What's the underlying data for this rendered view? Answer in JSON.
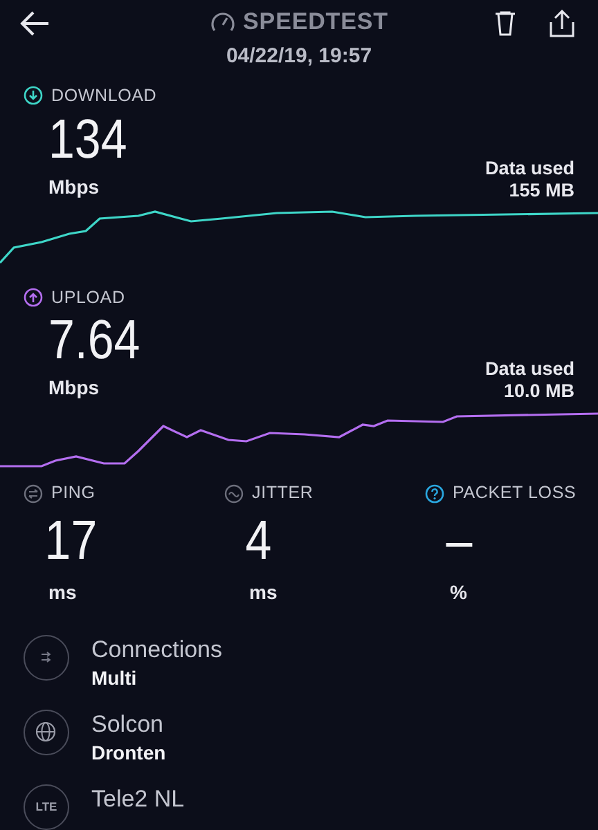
{
  "header": {
    "title": "SPEEDTEST",
    "date": "04/22/19, 19:57"
  },
  "results": [
    {
      "kind": "download",
      "label": "DOWNLOAD",
      "value": "134",
      "unit": "Mbps",
      "data_label": "Data used",
      "data_value": "155 MB",
      "color": "#3ed6c8"
    },
    {
      "kind": "upload",
      "label": "UPLOAD",
      "value": "7.64",
      "unit": "Mbps",
      "data_label": "Data used",
      "data_value": "10.0 MB",
      "color": "#b46ef0"
    }
  ],
  "metrics": [
    {
      "kind": "ping",
      "label": "PING",
      "value": "17",
      "unit": "ms"
    },
    {
      "kind": "jitter",
      "label": "JITTER",
      "value": "4",
      "unit": "ms"
    },
    {
      "kind": "loss",
      "label": "PACKET LOSS",
      "value": "–",
      "unit": "%"
    }
  ],
  "details": [
    {
      "kind": "arrows",
      "title": "Connections",
      "subtitle": "Multi"
    },
    {
      "kind": "globe",
      "title": "Solcon",
      "subtitle": "Dronten"
    },
    {
      "kind": "text",
      "icon_text": "LTE",
      "title": "Tele2 NL"
    }
  ]
}
